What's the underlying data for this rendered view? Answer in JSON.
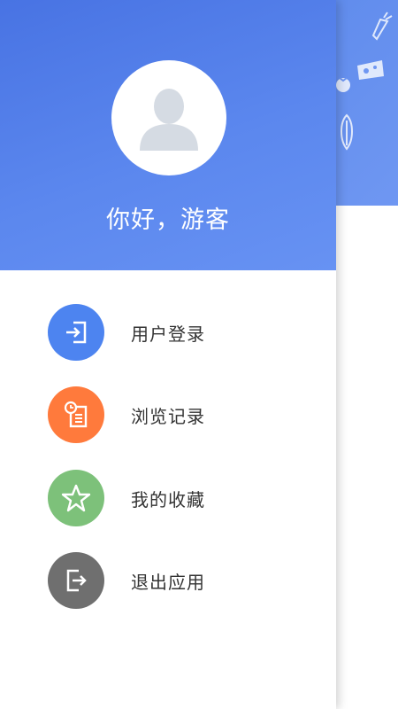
{
  "drawer": {
    "greeting": "你好，游客",
    "avatar_icon": "user-placeholder-icon",
    "header_color": "#4f7fe6",
    "menu": [
      {
        "label": "用户登录",
        "icon": "login-icon",
        "color": "#4d84f0"
      },
      {
        "label": "浏览记录",
        "icon": "history-icon",
        "color": "#ff7a3c"
      },
      {
        "label": "我的收藏",
        "icon": "star-icon",
        "color": "#7dc17a"
      },
      {
        "label": "退出应用",
        "icon": "exit-icon",
        "color": "#6f6f6f"
      }
    ]
  },
  "background": {
    "doodle_icons": [
      "carrot-icon",
      "cheese-icon",
      "tomato-icon",
      "corn-icon"
    ]
  }
}
